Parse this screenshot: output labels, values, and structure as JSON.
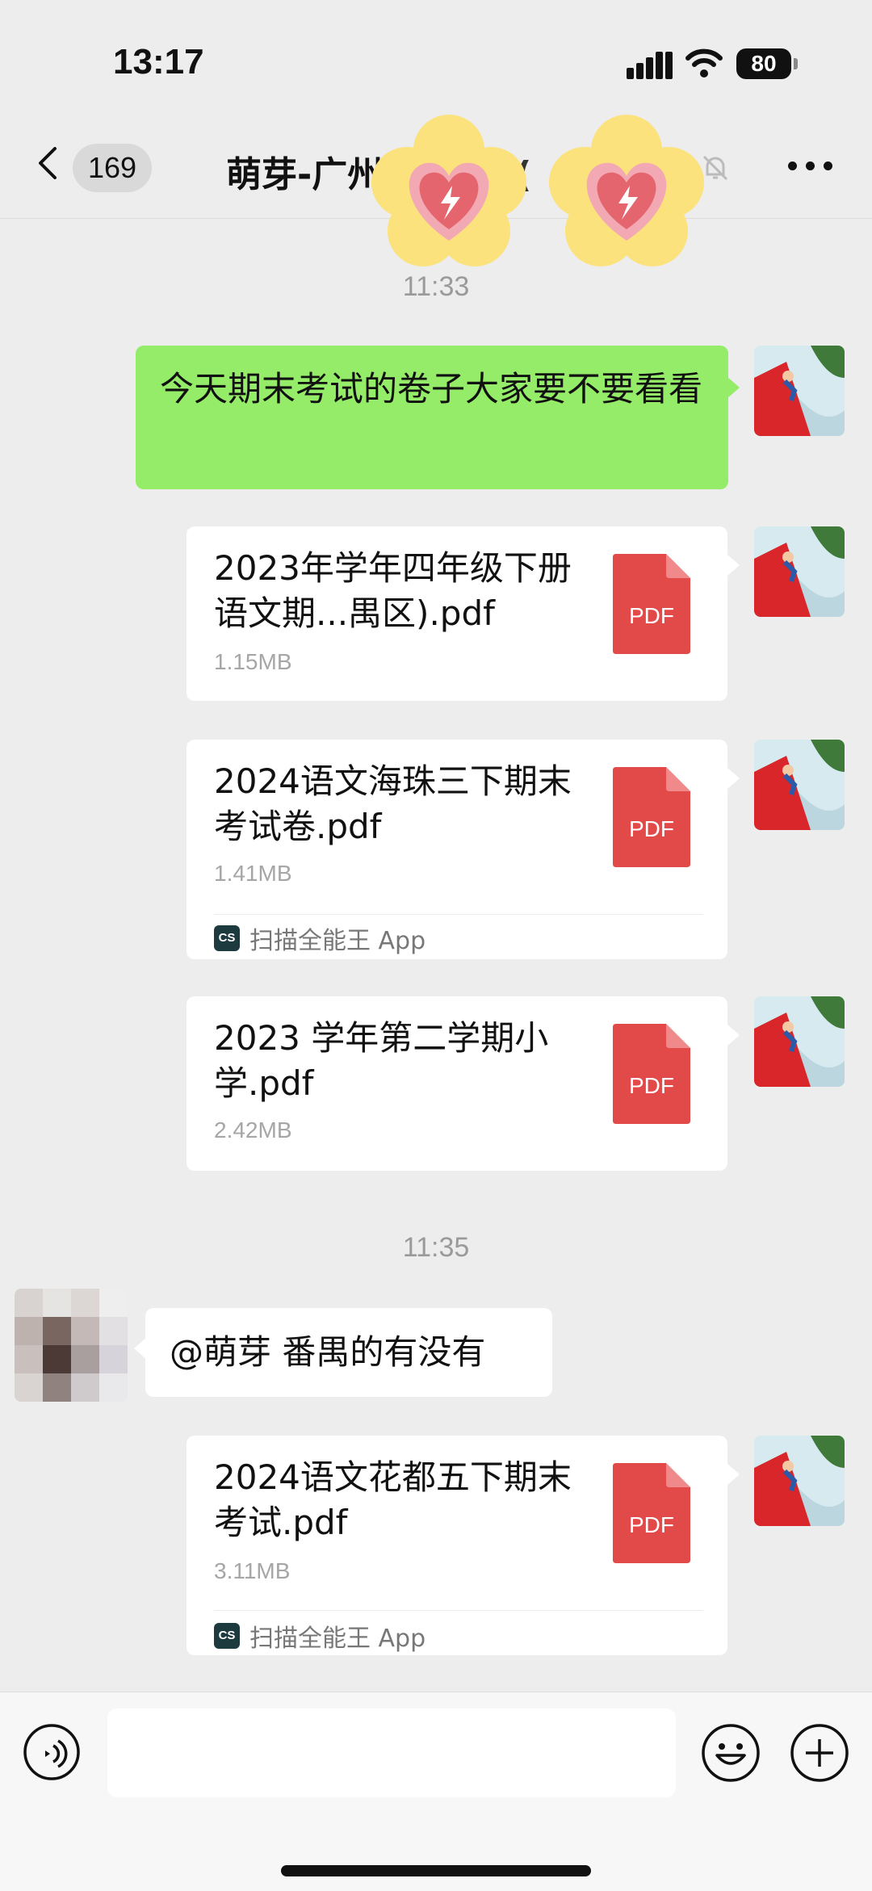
{
  "status_bar": {
    "time": "13:17",
    "battery": "80"
  },
  "nav": {
    "unread_count": "169",
    "title": "萌芽-广州",
    "title_tail": "群("
  },
  "timestamps": [
    "11:33",
    "11:35"
  ],
  "messages": {
    "m1": {
      "text": "今天期末考试的卷子大家要不要看看"
    },
    "f1": {
      "name": "2023年学年四年级下册语文期...禺区).pdf",
      "size": "1.15MB",
      "icon_label": "PDF"
    },
    "f2": {
      "name": "2024语文海珠三下期末考试卷.pdf",
      "size": "1.41MB",
      "icon_label": "PDF",
      "app_logo": "CS",
      "app_name": "扫描全能王 App"
    },
    "f3": {
      "name": "2023 学年第二学期小学.pdf",
      "size": "2.42MB",
      "icon_label": "PDF"
    },
    "m2": {
      "text": "@萌芽 番禺的有没有"
    },
    "f4": {
      "name": "2024语文花都五下期末考试.pdf",
      "size": "3.11MB",
      "icon_label": "PDF",
      "app_logo": "CS",
      "app_name": "扫描全能王 App"
    }
  },
  "input": {
    "value": ""
  },
  "colors": {
    "background": "#ededed",
    "my_bubble": "#95ec69",
    "pdf_red": "#e24a4a",
    "time_gray": "#9a9a9a"
  },
  "icons": [
    "back-chevron-icon",
    "mute-bell-icon",
    "more-dots-icon",
    "pdf-file-icon",
    "voice-icon",
    "emoji-icon",
    "plus-icon"
  ]
}
